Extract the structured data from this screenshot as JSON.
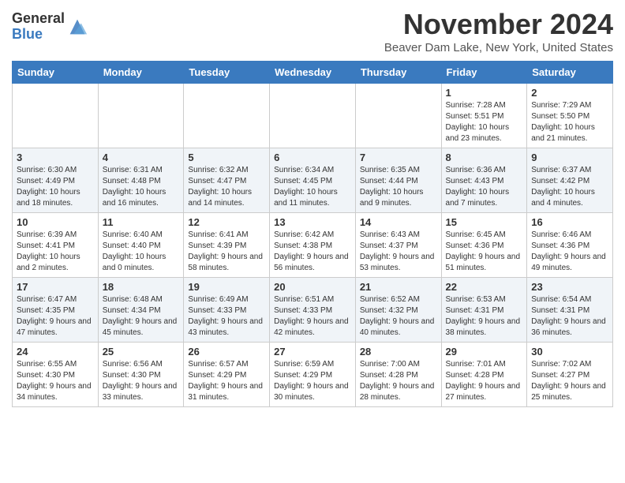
{
  "header": {
    "logo_general": "General",
    "logo_blue": "Blue",
    "month_title": "November 2024",
    "location": "Beaver Dam Lake, New York, United States"
  },
  "weekdays": [
    "Sunday",
    "Monday",
    "Tuesday",
    "Wednesday",
    "Thursday",
    "Friday",
    "Saturday"
  ],
  "weeks": [
    [
      {
        "day": "",
        "info": ""
      },
      {
        "day": "",
        "info": ""
      },
      {
        "day": "",
        "info": ""
      },
      {
        "day": "",
        "info": ""
      },
      {
        "day": "",
        "info": ""
      },
      {
        "day": "1",
        "info": "Sunrise: 7:28 AM\nSunset: 5:51 PM\nDaylight: 10 hours and 23 minutes."
      },
      {
        "day": "2",
        "info": "Sunrise: 7:29 AM\nSunset: 5:50 PM\nDaylight: 10 hours and 21 minutes."
      }
    ],
    [
      {
        "day": "3",
        "info": "Sunrise: 6:30 AM\nSunset: 4:49 PM\nDaylight: 10 hours and 18 minutes."
      },
      {
        "day": "4",
        "info": "Sunrise: 6:31 AM\nSunset: 4:48 PM\nDaylight: 10 hours and 16 minutes."
      },
      {
        "day": "5",
        "info": "Sunrise: 6:32 AM\nSunset: 4:47 PM\nDaylight: 10 hours and 14 minutes."
      },
      {
        "day": "6",
        "info": "Sunrise: 6:34 AM\nSunset: 4:45 PM\nDaylight: 10 hours and 11 minutes."
      },
      {
        "day": "7",
        "info": "Sunrise: 6:35 AM\nSunset: 4:44 PM\nDaylight: 10 hours and 9 minutes."
      },
      {
        "day": "8",
        "info": "Sunrise: 6:36 AM\nSunset: 4:43 PM\nDaylight: 10 hours and 7 minutes."
      },
      {
        "day": "9",
        "info": "Sunrise: 6:37 AM\nSunset: 4:42 PM\nDaylight: 10 hours and 4 minutes."
      }
    ],
    [
      {
        "day": "10",
        "info": "Sunrise: 6:39 AM\nSunset: 4:41 PM\nDaylight: 10 hours and 2 minutes."
      },
      {
        "day": "11",
        "info": "Sunrise: 6:40 AM\nSunset: 4:40 PM\nDaylight: 10 hours and 0 minutes."
      },
      {
        "day": "12",
        "info": "Sunrise: 6:41 AM\nSunset: 4:39 PM\nDaylight: 9 hours and 58 minutes."
      },
      {
        "day": "13",
        "info": "Sunrise: 6:42 AM\nSunset: 4:38 PM\nDaylight: 9 hours and 56 minutes."
      },
      {
        "day": "14",
        "info": "Sunrise: 6:43 AM\nSunset: 4:37 PM\nDaylight: 9 hours and 53 minutes."
      },
      {
        "day": "15",
        "info": "Sunrise: 6:45 AM\nSunset: 4:36 PM\nDaylight: 9 hours and 51 minutes."
      },
      {
        "day": "16",
        "info": "Sunrise: 6:46 AM\nSunset: 4:36 PM\nDaylight: 9 hours and 49 minutes."
      }
    ],
    [
      {
        "day": "17",
        "info": "Sunrise: 6:47 AM\nSunset: 4:35 PM\nDaylight: 9 hours and 47 minutes."
      },
      {
        "day": "18",
        "info": "Sunrise: 6:48 AM\nSunset: 4:34 PM\nDaylight: 9 hours and 45 minutes."
      },
      {
        "day": "19",
        "info": "Sunrise: 6:49 AM\nSunset: 4:33 PM\nDaylight: 9 hours and 43 minutes."
      },
      {
        "day": "20",
        "info": "Sunrise: 6:51 AM\nSunset: 4:33 PM\nDaylight: 9 hours and 42 minutes."
      },
      {
        "day": "21",
        "info": "Sunrise: 6:52 AM\nSunset: 4:32 PM\nDaylight: 9 hours and 40 minutes."
      },
      {
        "day": "22",
        "info": "Sunrise: 6:53 AM\nSunset: 4:31 PM\nDaylight: 9 hours and 38 minutes."
      },
      {
        "day": "23",
        "info": "Sunrise: 6:54 AM\nSunset: 4:31 PM\nDaylight: 9 hours and 36 minutes."
      }
    ],
    [
      {
        "day": "24",
        "info": "Sunrise: 6:55 AM\nSunset: 4:30 PM\nDaylight: 9 hours and 34 minutes."
      },
      {
        "day": "25",
        "info": "Sunrise: 6:56 AM\nSunset: 4:30 PM\nDaylight: 9 hours and 33 minutes."
      },
      {
        "day": "26",
        "info": "Sunrise: 6:57 AM\nSunset: 4:29 PM\nDaylight: 9 hours and 31 minutes."
      },
      {
        "day": "27",
        "info": "Sunrise: 6:59 AM\nSunset: 4:29 PM\nDaylight: 9 hours and 30 minutes."
      },
      {
        "day": "28",
        "info": "Sunrise: 7:00 AM\nSunset: 4:28 PM\nDaylight: 9 hours and 28 minutes."
      },
      {
        "day": "29",
        "info": "Sunrise: 7:01 AM\nSunset: 4:28 PM\nDaylight: 9 hours and 27 minutes."
      },
      {
        "day": "30",
        "info": "Sunrise: 7:02 AM\nSunset: 4:27 PM\nDaylight: 9 hours and 25 minutes."
      }
    ]
  ]
}
